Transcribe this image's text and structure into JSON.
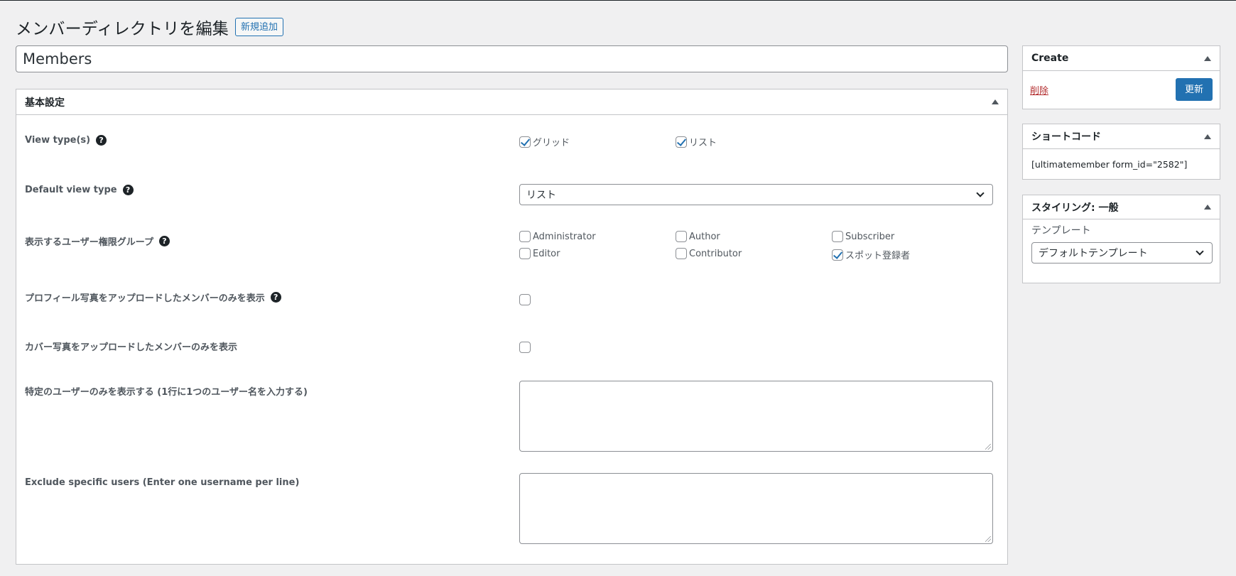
{
  "header": {
    "title": "メンバーディレクトリを編集",
    "add_new_label": "新規追加"
  },
  "post_title": {
    "value": "Members"
  },
  "basic_settings": {
    "title": "基本設定",
    "view_types": {
      "label": "View type(s)",
      "options": [
        {
          "label": "グリッド",
          "checked": true
        },
        {
          "label": "リスト",
          "checked": true
        }
      ]
    },
    "default_view": {
      "label": "Default view type",
      "selected": "リスト"
    },
    "roles": {
      "label": "表示するユーザー権限グループ",
      "options": [
        {
          "label": "Administrator",
          "checked": false
        },
        {
          "label": "Author",
          "checked": false
        },
        {
          "label": "Subscriber",
          "checked": false
        },
        {
          "label": "Editor",
          "checked": false
        },
        {
          "label": "Contributor",
          "checked": false
        },
        {
          "label": "スポット登録者",
          "checked": true
        }
      ]
    },
    "profile_photo_only": {
      "label": "プロフィール写真をアップロードしたメンバーのみを表示",
      "checked": false
    },
    "cover_photo_only": {
      "label": "カバー写真をアップロードしたメンバーのみを表示",
      "checked": false
    },
    "show_specific": {
      "label": "特定のユーザーのみを表示する (1行に1つのユーザー名を入力する)",
      "value": ""
    },
    "exclude_specific": {
      "label": "Exclude specific users (Enter one username per line)",
      "value": ""
    }
  },
  "create_box": {
    "title": "Create",
    "delete_label": "削除",
    "update_label": "更新"
  },
  "shortcode_box": {
    "title": "ショートコード",
    "code": "[ultimatemember form_id=\"2582\"]"
  },
  "styling_box": {
    "title": "スタイリング: 一般",
    "template_label": "テンプレート",
    "template_selected": "デフォルトテンプレート"
  },
  "icons": {
    "help": "question-circle-icon",
    "toggle": "triangle-up-icon",
    "select": "chevron-down-icon"
  },
  "colors": {
    "accent": "#2271b1",
    "danger": "#b32d2e",
    "background": "#f0f0f1"
  }
}
